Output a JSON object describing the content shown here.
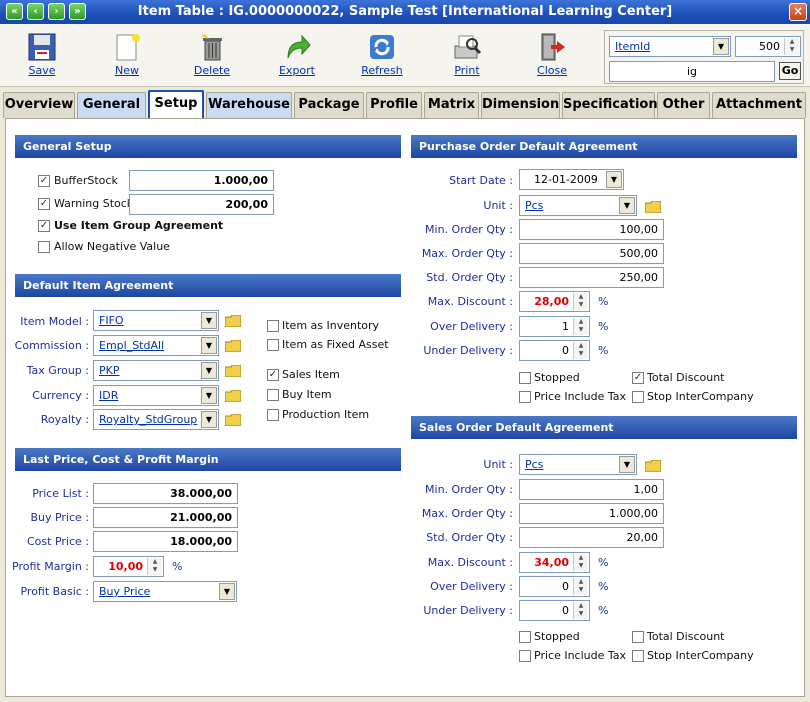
{
  "window": {
    "title": "Item Table : IG.0000000022, Sample Test [International Learning Center]"
  },
  "toolbar": {
    "save": "Save",
    "new": "New",
    "delete": "Delete",
    "export": "Export",
    "refresh": "Refresh",
    "print": "Print",
    "close": "Close"
  },
  "search": {
    "field": "ItemId",
    "limit": "500",
    "query": "ig",
    "go": "Go"
  },
  "tabs": [
    "Overview",
    "General",
    "Setup",
    "Warehouse",
    "Package",
    "Profile",
    "Matrix",
    "Dimension",
    "Specification",
    "Other",
    "Attachment"
  ],
  "active_tab": "Setup",
  "general_setup": {
    "title": "General Setup",
    "buffer_stock_label": "BufferStock",
    "buffer_stock": "1.000,00",
    "buffer_stock_checked": true,
    "warning_stock_label": "Warning Stock",
    "warning_stock": "200,00",
    "warning_stock_checked": true,
    "use_group_label": "Use Item Group Agreement",
    "use_group_checked": true,
    "allow_negative_label": "Allow Negative Value",
    "allow_negative_checked": false
  },
  "default_item": {
    "title": "Default Item Agreement",
    "model_label": "Item Model :",
    "model": "FIFO",
    "commission_label": "Commission :",
    "commission": "Empl_StdAll",
    "tax_label": "Tax Group :",
    "tax": "PKP",
    "currency_label": "Currency :",
    "currency": "IDR",
    "royalty_label": "Royalty :",
    "royalty": "Royalty_StdGroup",
    "as_inventory": "Item as Inventory",
    "as_fixed_asset": "Item as Fixed Asset",
    "sales_item": "Sales Item",
    "buy_item": "Buy Item",
    "production_item": "Production Item"
  },
  "price": {
    "title": "Last Price, Cost & Profit Margin",
    "price_list_label": "Price List :",
    "price_list": "38.000,00",
    "buy_price_label": "Buy Price :",
    "buy_price": "21.000,00",
    "cost_price_label": "Cost Price :",
    "cost_price": "18.000,00",
    "margin_label": "Profit Margin :",
    "margin": "10,00",
    "basic_label": "Profit Basic :",
    "basic": "Buy Price"
  },
  "purchase": {
    "title": "Purchase Order Default Agreement",
    "start_label": "Start Date :",
    "start": "12-01-2009",
    "unit_label": "Unit :",
    "unit": "Pcs",
    "min_label": "Min. Order Qty :",
    "min": "100,00",
    "max_label": "Max. Order Qty :",
    "max": "500,00",
    "std_label": "Std. Order Qty :",
    "std": "250,00",
    "discount_label": "Max. Discount :",
    "discount": "28,00",
    "over_label": "Over Delivery :",
    "over": "1",
    "under_label": "Under Delivery :",
    "under": "0",
    "stopped": "Stopped",
    "total_discount": "Total Discount",
    "price_include_tax": "Price Include Tax",
    "stop_intercompany": "Stop InterCompany"
  },
  "sales": {
    "title": "Sales Order Default Agreement",
    "unit_label": "Unit :",
    "unit": "Pcs",
    "min_label": "Min. Order Qty :",
    "min": "1,00",
    "max_label": "Max. Order Qty :",
    "max": "1.000,00",
    "std_label": "Std. Order Qty :",
    "std": "20,00",
    "discount_label": "Max. Discount :",
    "discount": "34,00",
    "over_label": "Over Delivery :",
    "over": "0",
    "under_label": "Under Delivery :",
    "under": "0",
    "stopped": "Stopped",
    "total_discount": "Total Discount",
    "price_include_tax": "Price Include Tax",
    "stop_intercompany": "Stop InterCompany"
  },
  "percent_sign": "%"
}
